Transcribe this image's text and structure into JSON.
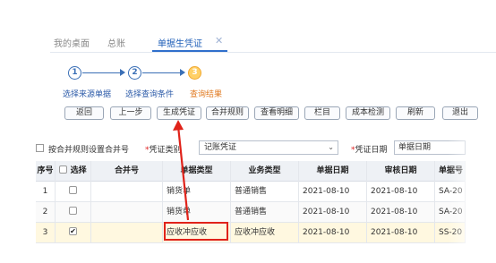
{
  "tabs": [
    {
      "label": "我的桌面"
    },
    {
      "label": "总账"
    },
    {
      "label": "单据生凭证",
      "active": true
    }
  ],
  "tab_close_glyph": "✕",
  "steps": [
    {
      "number": "1",
      "label": "选择来源单据"
    },
    {
      "number": "2",
      "label": "选择查询条件"
    },
    {
      "number": "3",
      "label": "查询结果",
      "current": true
    }
  ],
  "toolbar": {
    "buttons": [
      "返回",
      "上一步",
      "生成凭证",
      "合并规则",
      "查看明细",
      "栏目",
      "成本检测",
      "刷新",
      "退出"
    ]
  },
  "filter": {
    "merge_rule_label": "按合并规则设置合并号",
    "voucher_type_label": "凭证类别",
    "voucher_type_value": "记账凭证",
    "voucher_date_label": "凭证日期",
    "voucher_date_value": "单据日期",
    "required_mark": "*"
  },
  "table": {
    "columns": [
      "序号",
      "选择",
      "合并号",
      "单据类型",
      "业务类型",
      "单据日期",
      "审核日期",
      "单据号"
    ],
    "rows": [
      {
        "no": "1",
        "checked": false,
        "merge": "",
        "doc_type": "销货单",
        "biz_type": "普通销售",
        "doc_date": "2021-08-10",
        "audit_date": "2021-08-10",
        "doc_no": "SA-20"
      },
      {
        "no": "2",
        "checked": false,
        "merge": "",
        "doc_type": "销货单",
        "biz_type": "普通销售",
        "doc_date": "2021-08-10",
        "audit_date": "2021-08-10",
        "doc_no": "SA-20"
      },
      {
        "no": "3",
        "checked": true,
        "merge": "",
        "doc_type": "应收冲应收",
        "biz_type": "应收冲应收",
        "doc_date": "2021-08-10",
        "audit_date": "2021-08-10",
        "doc_no": "SS-20"
      }
    ]
  },
  "colors": {
    "accent": "#2f6fcc",
    "highlight_red": "#e0231a",
    "current_step": "#ffd066"
  },
  "icons": {
    "tab_close": "close-icon",
    "select_caret": "chevron-down-icon",
    "annotation": "red-arrow-icon"
  }
}
